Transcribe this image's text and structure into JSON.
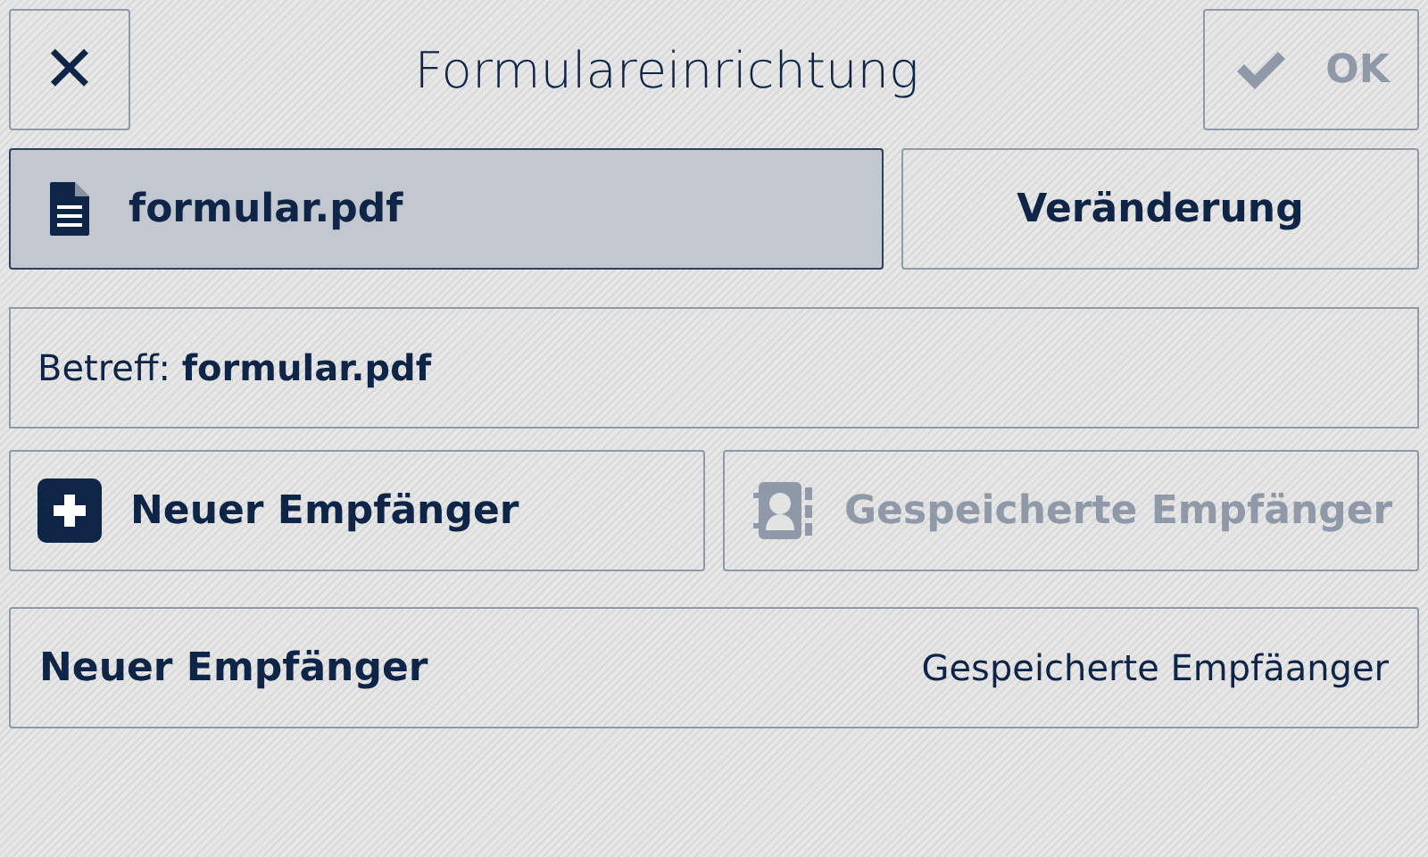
{
  "header": {
    "close_label": "✕",
    "title": "Formulareinrichtung",
    "ok_button": {
      "label": "OK",
      "disabled": true
    }
  },
  "file_buttons": [
    {
      "kind": "file",
      "label": "formular.pdf",
      "selected": true
    },
    {
      "kind": "plain",
      "label": "Veränderung",
      "selected": false
    }
  ],
  "subject": {
    "label": "Betreff:",
    "value": "formular.pdf"
  },
  "recipient_buttons": [
    {
      "kind": "add",
      "label": "Neuer Empfänger",
      "disabled": false
    },
    {
      "kind": "addressbook",
      "label": "Gespeicherte Empfänger",
      "disabled": true
    }
  ],
  "summary_row": {
    "left": "Neuer Empfänger",
    "right": "Gespeicherte Empfäanger"
  }
}
